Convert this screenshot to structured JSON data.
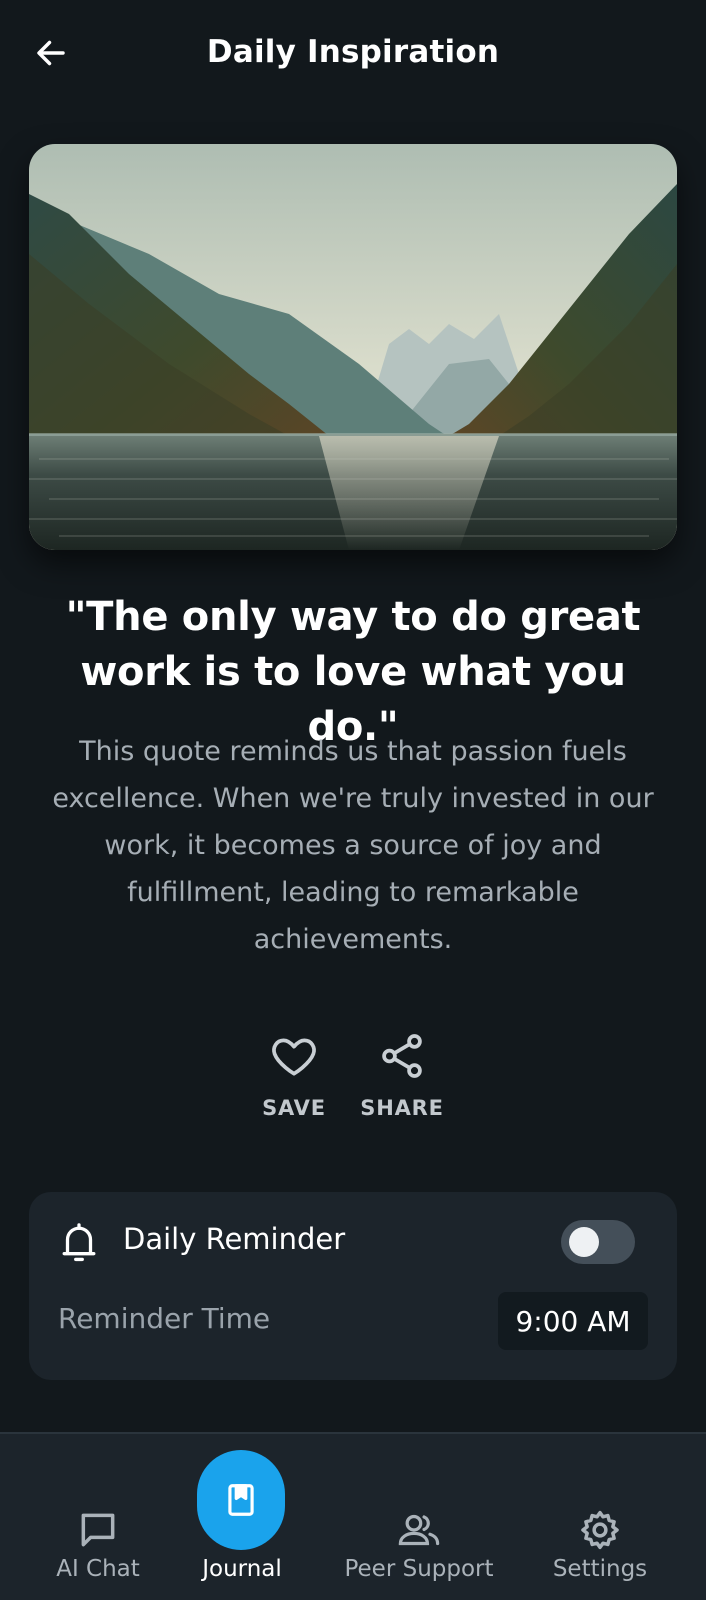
{
  "header": {
    "title": "Daily Inspiration",
    "back_icon": "arrow-left-icon"
  },
  "hero": {
    "image": "mountain-lake-landscape"
  },
  "quote": {
    "text": "\"The only way to do great work is to love what you do.\"",
    "description": "This quote reminds us that passion fuels excellence. When we're truly invested in our work, it becomes a source of joy and fulfillment, leading to remarkable achievements."
  },
  "actions": {
    "save_label": "SAVE",
    "share_label": "SHARE"
  },
  "reminder": {
    "title": "Daily Reminder",
    "enabled": false,
    "time_label": "Reminder Time",
    "time_value": "9:00 AM"
  },
  "nav": {
    "items": [
      {
        "label": "AI Chat",
        "icon": "chat-icon",
        "active": false
      },
      {
        "label": "Journal",
        "icon": "journal-icon",
        "active": true
      },
      {
        "label": "Peer Support",
        "icon": "people-icon",
        "active": false
      },
      {
        "label": "Settings",
        "icon": "gear-icon",
        "active": false
      }
    ]
  },
  "colors": {
    "background": "#12181c",
    "card": "#1c242b",
    "accent": "#1aa3ec",
    "muted_text": "#a6aeb5"
  }
}
